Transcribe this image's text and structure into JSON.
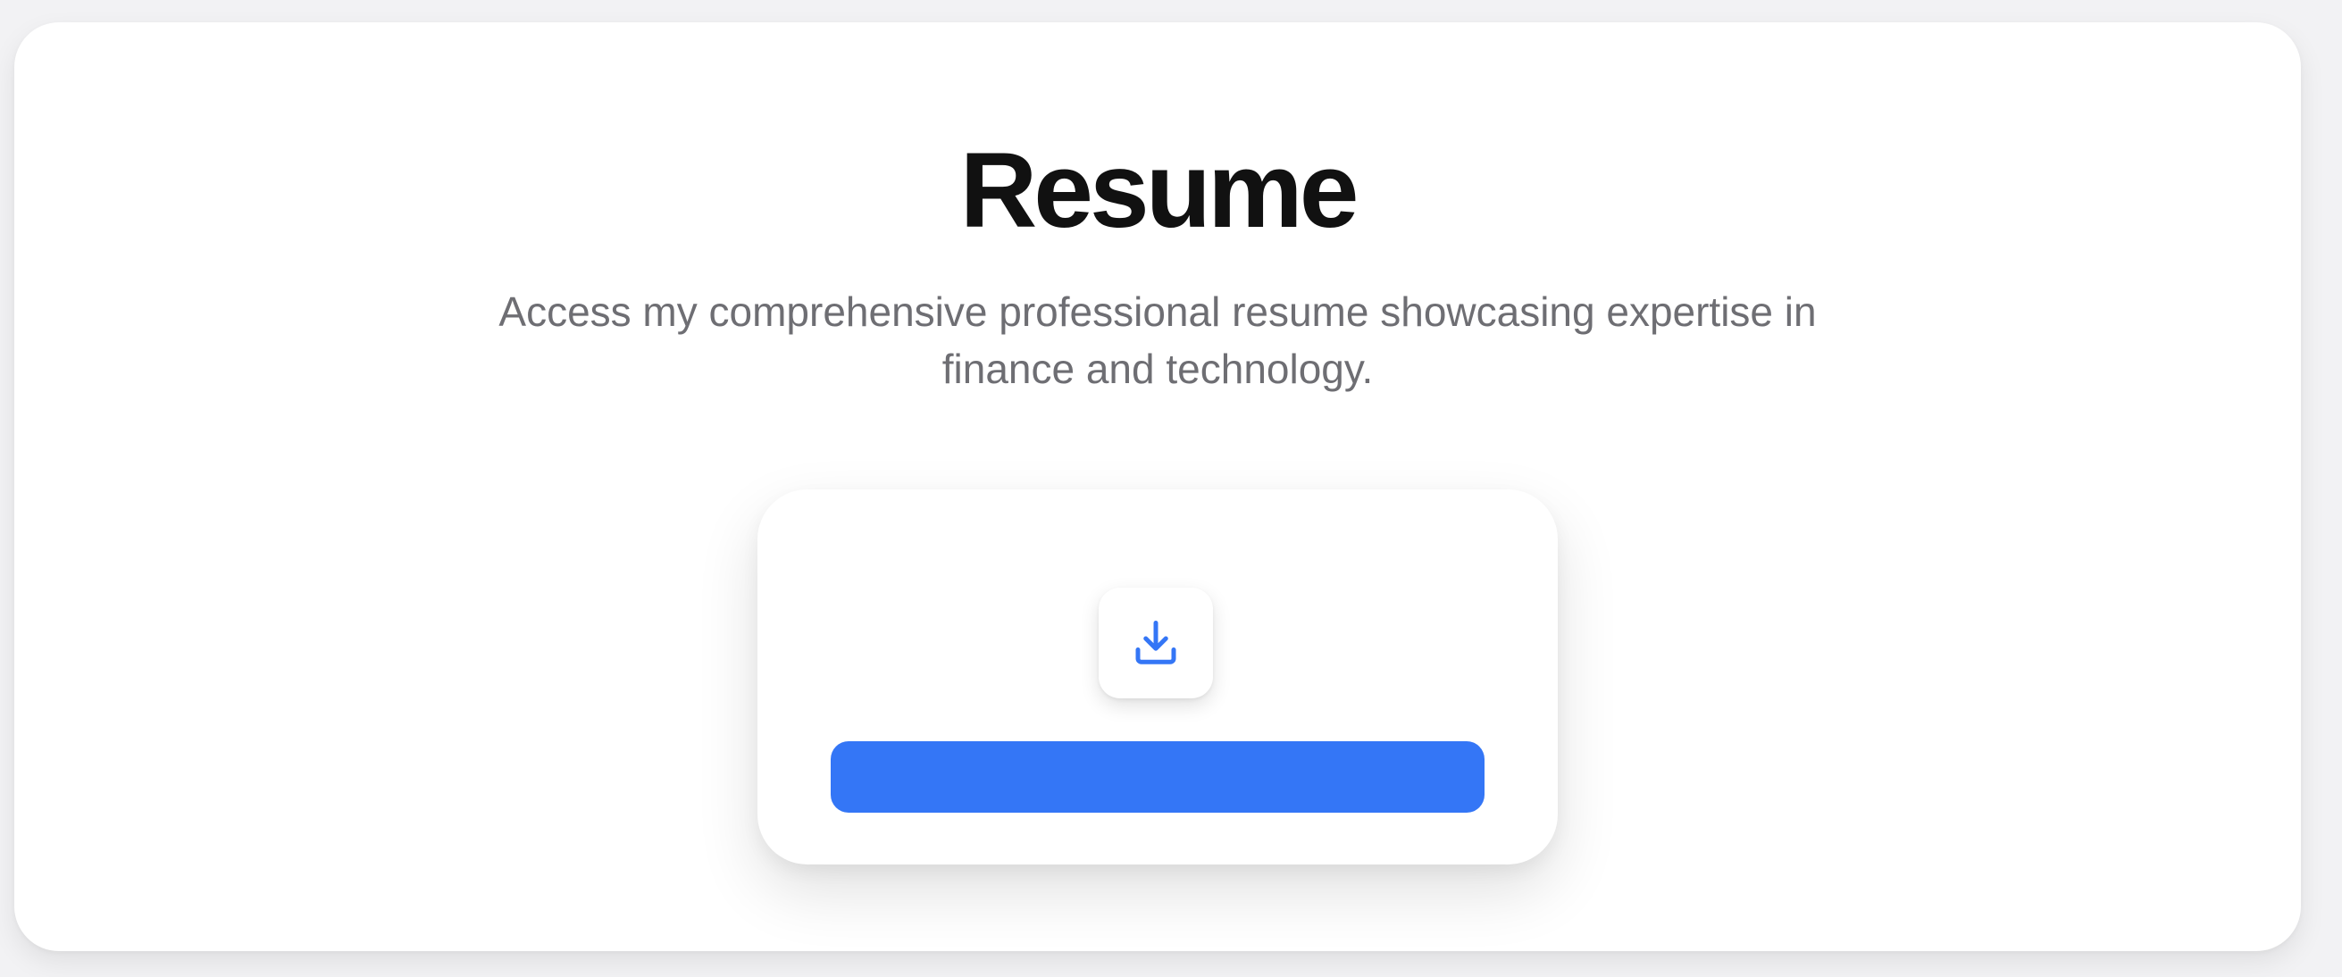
{
  "hero": {
    "title": "Resume",
    "subtitle": "Access my comprehensive professional resume showcasing expertise in finance and technology."
  },
  "download_card": {
    "icon": "download-icon",
    "button_label": ""
  },
  "colors": {
    "accent": "#3476f6",
    "title_text": "#111111",
    "subtitle_text": "#6e6e73",
    "page_background": "#f2f2f4",
    "card_background": "#ffffff"
  }
}
